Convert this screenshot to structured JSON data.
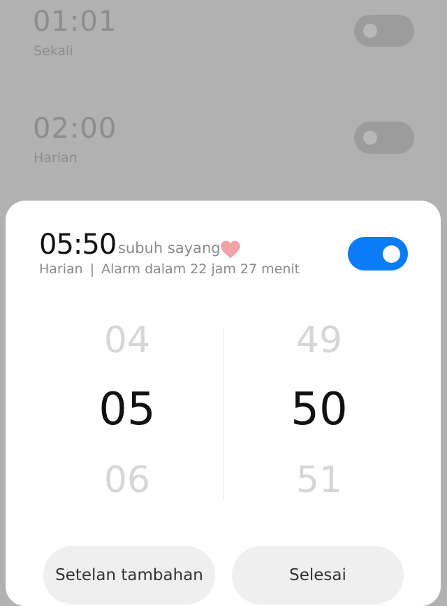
{
  "alarms": [
    {
      "time": "01:01",
      "repeat": "Sekali"
    },
    {
      "time": "02:00",
      "repeat": "Harian"
    }
  ],
  "editor": {
    "time": "05:50",
    "label": "subuh sayang",
    "repeat": "Harian",
    "separator": "|",
    "countdown": "Alarm dalam 22 jam 27 menit",
    "enabled": true,
    "accent_color": "#0a7cf8"
  },
  "picker": {
    "hours": {
      "prev": "04",
      "selected": "05",
      "next": "06"
    },
    "minutes": {
      "prev": "49",
      "selected": "50",
      "next": "51"
    }
  },
  "buttons": {
    "more_settings": "Setelan tambahan",
    "done": "Selesai"
  }
}
